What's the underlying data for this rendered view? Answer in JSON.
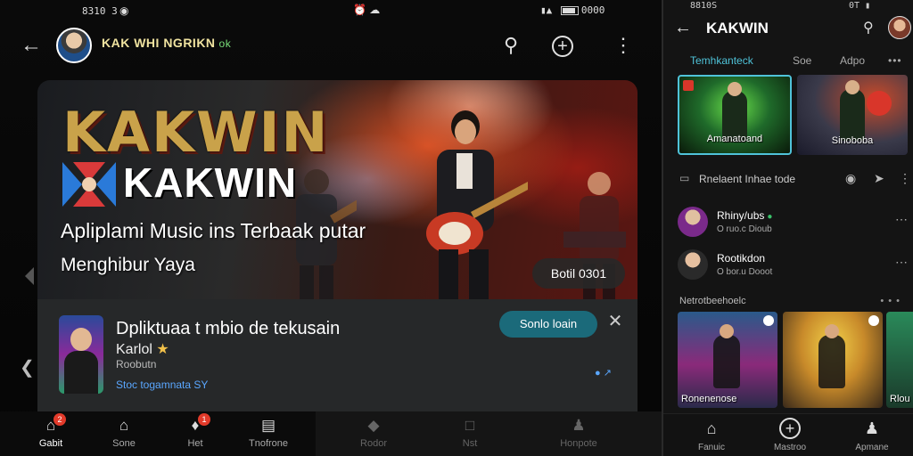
{
  "left": {
    "status": {
      "time": "8310 3",
      "wifi_icon": "wifi-icon",
      "center": "⏰ ☁",
      "right": "0000"
    },
    "topbar": {
      "channel_name": "KAK WHI NGRIKN",
      "verified": "ok"
    },
    "hero": {
      "brand_line1": "KAKWIN",
      "brand_line2": "KAKWIN",
      "tagline1": "Apliplami Music ins Terbaak putar",
      "tagline2": "Menghibur Yaya",
      "cta": "Botil 0301"
    },
    "card": {
      "title": "Dpliktuaa t mbio de tekusain",
      "subtitle": "Karlol",
      "meta": "Roobutn",
      "link": "Stoc togamnata",
      "link_suffix": "SY",
      "cta": "Sonlo loain"
    },
    "bottomnav": [
      {
        "label": "Gabit",
        "icon": "home-icon",
        "badge": "2"
      },
      {
        "label": "Sone",
        "icon": "home-outline-icon",
        "badge": ""
      },
      {
        "label": "Het",
        "icon": "chat-icon",
        "badge": "1"
      },
      {
        "label": "Tnofrone",
        "icon": "document-icon",
        "badge": ""
      },
      {
        "label": "Rodor",
        "icon": "bell-icon",
        "badge": ""
      },
      {
        "label": "Nst",
        "icon": "square-icon",
        "badge": ""
      },
      {
        "label": "Honpote",
        "icon": "person-icon",
        "badge": ""
      }
    ]
  },
  "right": {
    "status": {
      "left": "8810S",
      "right": "0T"
    },
    "title": "KAKWIN",
    "tabs": [
      "Temhkanteck",
      "Soe",
      "Adpo",
      "•••"
    ],
    "thumbs": [
      {
        "caption": "Amanatoand"
      },
      {
        "caption": "Sinoboba"
      }
    ],
    "section_row": "Rnelaent Inhae tode",
    "list": [
      {
        "name": "Rhiny/ubs",
        "sub": "O ruo.c Dioub"
      },
      {
        "name": "Rootikdon",
        "sub": "O bor.u Dooot"
      }
    ],
    "sub_heading": "Netrotbeehoelc",
    "sub_more": "• • •",
    "grid": [
      {
        "caption": "Ronenenose"
      },
      {
        "caption": ""
      },
      {
        "caption": "Rlou"
      }
    ],
    "bottomnav": [
      {
        "label": "Fanuic",
        "icon": "home-outline-icon"
      },
      {
        "label": "Mastroo",
        "icon": "plus-circle-icon"
      },
      {
        "label": "Apmane",
        "icon": "person-icon"
      }
    ]
  }
}
